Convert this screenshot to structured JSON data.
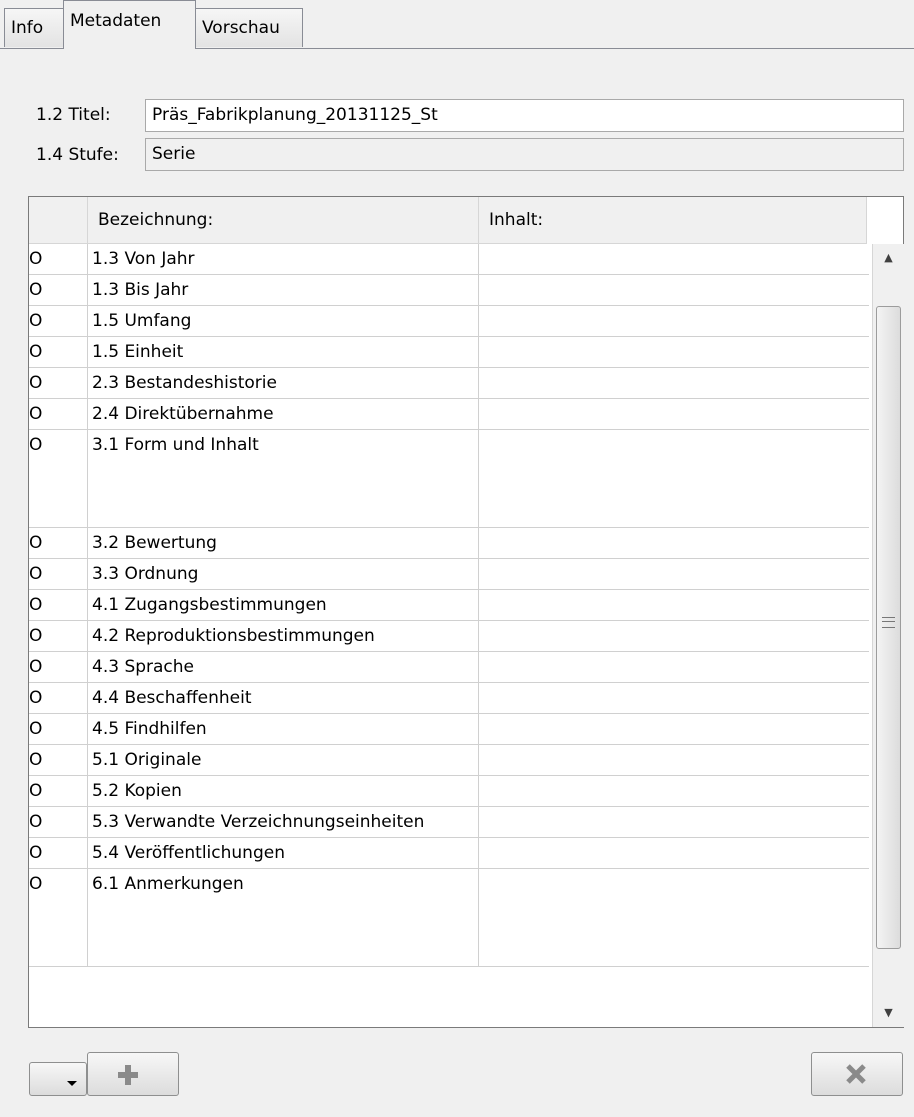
{
  "tabs": [
    "Info",
    "Metadaten",
    "Vorschau"
  ],
  "active_tab": "Metadaten",
  "fields": {
    "titel_label": "1.2 Titel:",
    "titel_value": "Präs_Fabrikplanung_20131125_St",
    "stufe_label": "1.4 Stufe:",
    "stufe_value": "Serie"
  },
  "table": {
    "headers": [
      "Bezeichnung:",
      "Inhalt:"
    ],
    "rows": [
      {
        "marker": "O",
        "label": "1.3 Von Jahr",
        "content": ""
      },
      {
        "marker": "O",
        "label": "1.3 Bis Jahr",
        "content": ""
      },
      {
        "marker": "O",
        "label": "1.5 Umfang",
        "content": ""
      },
      {
        "marker": "O",
        "label": "1.5 Einheit",
        "content": ""
      },
      {
        "marker": "O",
        "label": "2.3 Bestandeshistorie",
        "content": ""
      },
      {
        "marker": "O",
        "label": "2.4 Direktübernahme",
        "content": ""
      },
      {
        "marker": "O",
        "label": "3.1 Form und Inhalt",
        "content": "",
        "tall": true
      },
      {
        "marker": "O",
        "label": "3.2 Bewertung",
        "content": ""
      },
      {
        "marker": "O",
        "label": "3.3 Ordnung",
        "content": ""
      },
      {
        "marker": "O",
        "label": "4.1 Zugangsbestimmungen",
        "content": ""
      },
      {
        "marker": "O",
        "label": "4.2 Reproduktionsbestimmungen",
        "content": ""
      },
      {
        "marker": "O",
        "label": "4.3 Sprache",
        "content": ""
      },
      {
        "marker": "O",
        "label": "4.4 Beschaffenheit",
        "content": ""
      },
      {
        "marker": "O",
        "label": "4.5 Findhilfen",
        "content": ""
      },
      {
        "marker": "O",
        "label": "5.1 Originale",
        "content": ""
      },
      {
        "marker": "O",
        "label": "5.2 Kopien",
        "content": ""
      },
      {
        "marker": "O",
        "label": "5.3 Verwandte Verzeichnungseinheiten",
        "content": ""
      },
      {
        "marker": "O",
        "label": "5.4 Veröffentlichungen",
        "content": ""
      },
      {
        "marker": "O",
        "label": "6.1 Anmerkungen",
        "content": "",
        "tall": true
      }
    ]
  },
  "icons": {
    "dropdown": "chevron-down-icon",
    "add": "plus-icon",
    "delete": "close-icon",
    "scroll_up": "arrow-up-icon",
    "scroll_down": "arrow-down-icon",
    "scroll_grip": "grip-icon"
  },
  "colors": {
    "background": "#f0f0f0",
    "border": "#898c95",
    "icon_gray": "#8a8a8a"
  }
}
